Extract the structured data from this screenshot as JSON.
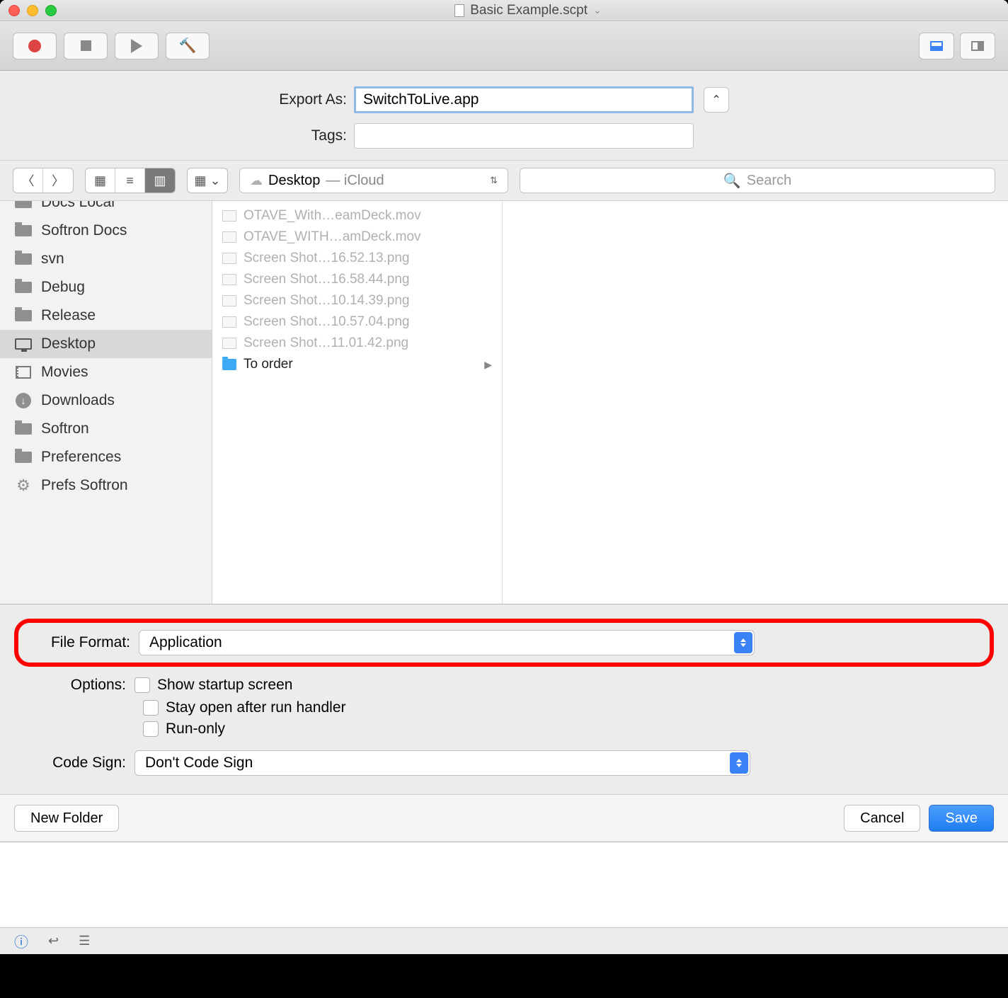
{
  "window": {
    "title": "Basic Example.scpt"
  },
  "export": {
    "export_as_label": "Export As:",
    "filename": "SwitchToLive.app",
    "tags_label": "Tags:"
  },
  "location": {
    "name": "Desktop",
    "sub": "— iCloud",
    "search_placeholder": "Search"
  },
  "sidebar": {
    "items": [
      {
        "label": "Docs Local",
        "icon": "folder",
        "cut": true
      },
      {
        "label": "Softron Docs",
        "icon": "folder"
      },
      {
        "label": "svn",
        "icon": "folder"
      },
      {
        "label": "Debug",
        "icon": "folder"
      },
      {
        "label": "Release",
        "icon": "folder"
      },
      {
        "label": "Desktop",
        "icon": "desktop",
        "selected": true
      },
      {
        "label": "Movies",
        "icon": "film"
      },
      {
        "label": "Downloads",
        "icon": "download"
      },
      {
        "label": "Softron",
        "icon": "folder"
      },
      {
        "label": "Preferences",
        "icon": "folder"
      },
      {
        "label": "Prefs Softron",
        "icon": "gear"
      }
    ]
  },
  "files": {
    "items": [
      {
        "name": "OTAVE_With…eamDeck.mov",
        "disabled": true
      },
      {
        "name": "OTAVE_WITH…amDeck.mov",
        "disabled": true
      },
      {
        "name": "Screen Shot…16.52.13.png",
        "disabled": true
      },
      {
        "name": "Screen Shot…16.58.44.png",
        "disabled": true
      },
      {
        "name": "Screen Shot…10.14.39.png",
        "disabled": true
      },
      {
        "name": "Screen Shot…10.57.04.png",
        "disabled": true
      },
      {
        "name": "Screen Shot…11.01.42.png",
        "disabled": true
      },
      {
        "name": "To order",
        "folder": true
      }
    ]
  },
  "format": {
    "file_format_label": "File Format:",
    "file_format_value": "Application",
    "options_label": "Options:",
    "opt_startup": "Show startup screen",
    "opt_stayopen": "Stay open after run handler",
    "opt_runonly": "Run-only",
    "codesign_label": "Code Sign:",
    "codesign_value": "Don't Code Sign"
  },
  "buttons": {
    "new_folder": "New Folder",
    "cancel": "Cancel",
    "save": "Save"
  }
}
